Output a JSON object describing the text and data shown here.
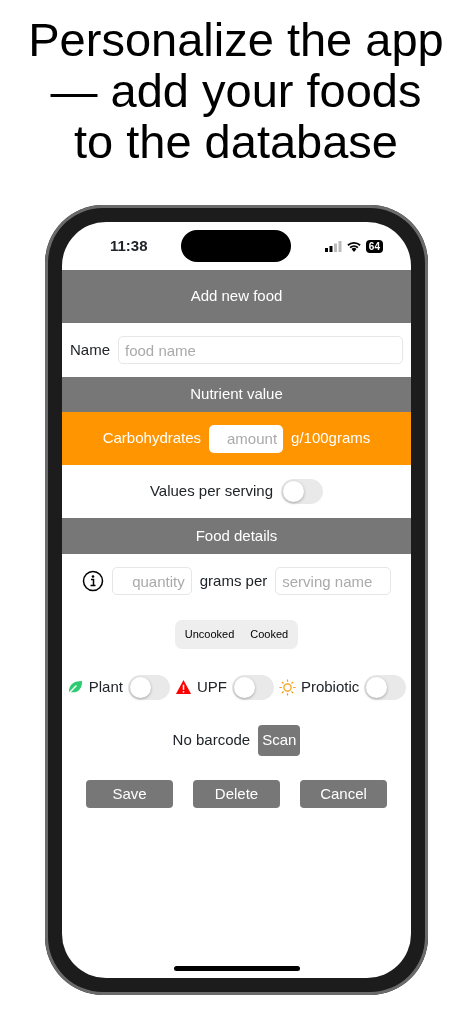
{
  "headline": [
    "Personalize the app",
    "— add your foods",
    "to the database"
  ],
  "status_bar": {
    "time": "11:38",
    "battery": "64"
  },
  "title": "Add new food",
  "name_field": {
    "label": "Name",
    "placeholder": "food name"
  },
  "nutrient_header": "Nutrient value",
  "nutrient": {
    "label": "Carbohydrates",
    "placeholder": "amount",
    "unit": "g/100grams"
  },
  "per_serving": {
    "label": "Values per serving",
    "on": false
  },
  "details_header": "Food details",
  "serving": {
    "quantity_placeholder": "quantity",
    "middle": "grams per",
    "name_placeholder": "serving name"
  },
  "segments": [
    {
      "label": "Uncooked",
      "selected": false
    },
    {
      "label": "Cooked",
      "selected": false
    }
  ],
  "flags": [
    {
      "kind": "leaf",
      "label": "Plant",
      "on": false
    },
    {
      "kind": "warning",
      "label": "UPF",
      "on": false
    },
    {
      "kind": "sun",
      "label": "Probiotic",
      "on": false
    }
  ],
  "barcode": {
    "label": "No barcode",
    "button": "Scan"
  },
  "buttons": [
    "Save",
    "Delete",
    "Cancel"
  ]
}
